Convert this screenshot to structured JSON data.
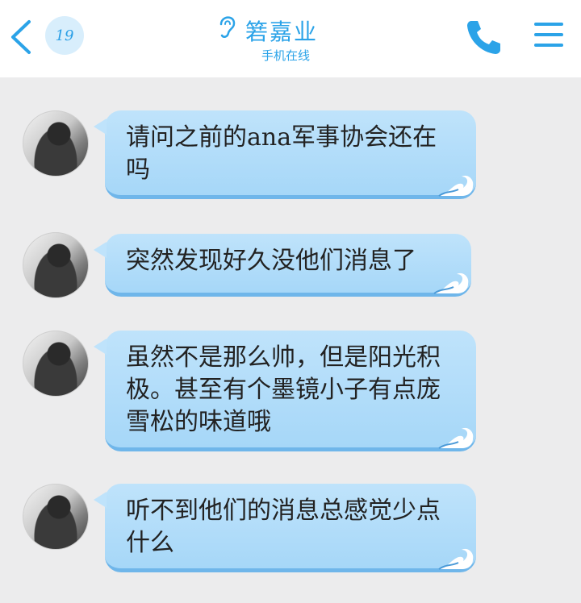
{
  "header": {
    "unread_count": "19",
    "contact_name": "箬嘉业",
    "status": "手机在线"
  },
  "messages": [
    {
      "text": "请问之前的ana军事协会还在吗"
    },
    {
      "text": "突然发现好久没他们消息了"
    },
    {
      "text": "虽然不是那么帅，但是阳光积极。甚至有个墨镜小子有点庞雪松的味道哦"
    },
    {
      "text": "听不到他们的消息总感觉少点什么"
    }
  ],
  "colors": {
    "accent": "#2ba3e8",
    "bubble": "#a6d7f8",
    "background": "#ececed"
  },
  "icons": [
    "back-arrow-icon",
    "ear-icon",
    "phone-icon",
    "menu-icon",
    "wave-icon"
  ]
}
